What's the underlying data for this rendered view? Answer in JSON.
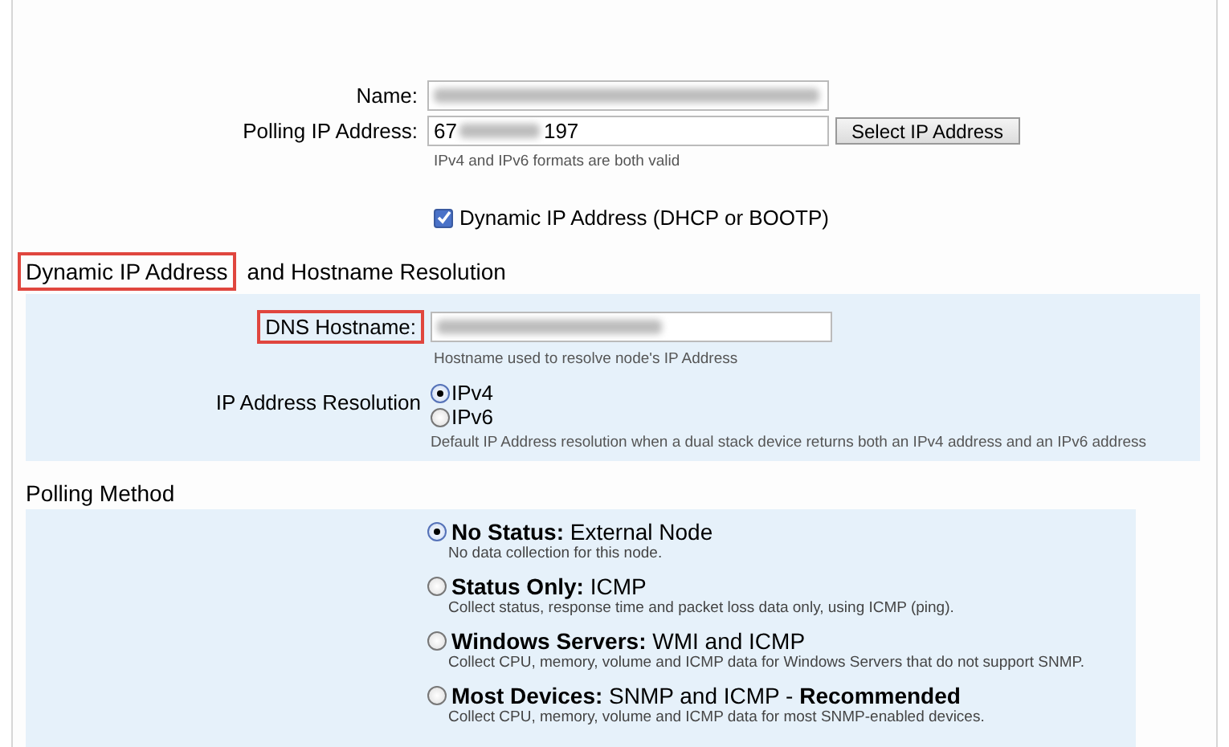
{
  "name_field": {
    "label": "Name:"
  },
  "polling_ip": {
    "label": "Polling IP Address:",
    "value_start": "67",
    "value_end": "197",
    "button": "Select IP Address",
    "hint": "IPv4 and IPv6 formats are both valid"
  },
  "dynamic_ip": {
    "label": "Dynamic IP Address (DHCP or BOOTP)",
    "checked": true
  },
  "dynamic_section": {
    "heading": [
      {
        "text": "Dynamic IP Address",
        "highlighted": true
      },
      {
        "text": "and Hostname Resolution",
        "highlighted": false
      }
    ],
    "dns_hostname": {
      "label": "DNS Hostname:",
      "highlighted": true,
      "hint": "Hostname used to resolve node's IP Address"
    },
    "resolution": {
      "label": "IP Address Resolution",
      "options": [
        {
          "label": "IPv4",
          "selected": true
        },
        {
          "label": "IPv6",
          "selected": false
        }
      ],
      "hint": "Default IP Address resolution when a dual stack device returns both an IPv4 address and an IPv6 address"
    }
  },
  "polling_method": {
    "heading": "Polling Method",
    "options": [
      {
        "title": "**No Status:** External Node",
        "description": "No data collection for this node.",
        "selected": true
      },
      {
        "title": "**Status Only:** ICMP",
        "description": "Collect status, response time and packet loss data only, using ICMP (ping).",
        "selected": false
      },
      {
        "title": "**Windows Servers:** WMI and ICMP",
        "description": "Collect CPU, memory, volume and ICMP data for Windows Servers that do not support SNMP.",
        "selected": false
      },
      {
        "title": "**Most Devices:** SNMP and ICMP - **Recommended**",
        "description": "Collect CPU, memory, volume and ICMP data for most SNMP-enabled devices.",
        "selected": false
      }
    ]
  }
}
